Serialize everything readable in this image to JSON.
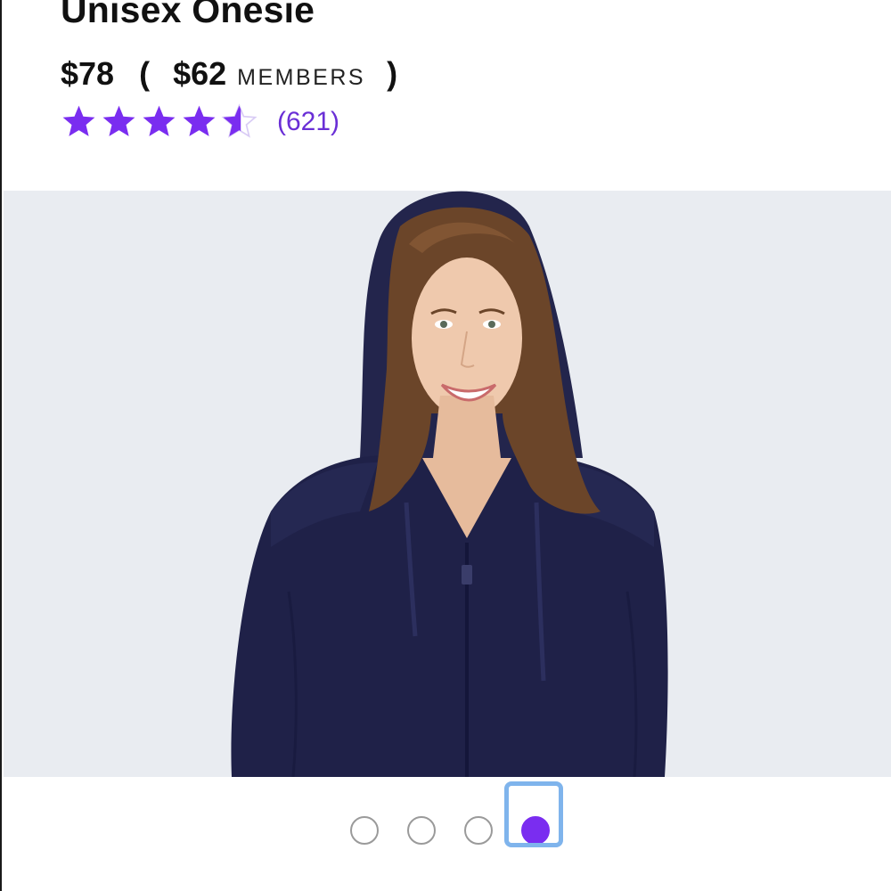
{
  "product": {
    "title": "Unisex Onesie",
    "price": "$78",
    "member_price": "$62",
    "member_label": "MEMBERS",
    "open_paren": "(",
    "close_paren": ")",
    "rating": 4.5,
    "rating_max": 5,
    "review_count": "(621)"
  },
  "carousel": {
    "total_slides": 4,
    "active_slide": 4,
    "image_alt": "woman-in-navy-hooded-onesie"
  },
  "colors": {
    "accent": "#7a2df0",
    "hero_bg": "#e9ecf1",
    "garment": "#1f2148",
    "focus": "#7fb4ec"
  }
}
